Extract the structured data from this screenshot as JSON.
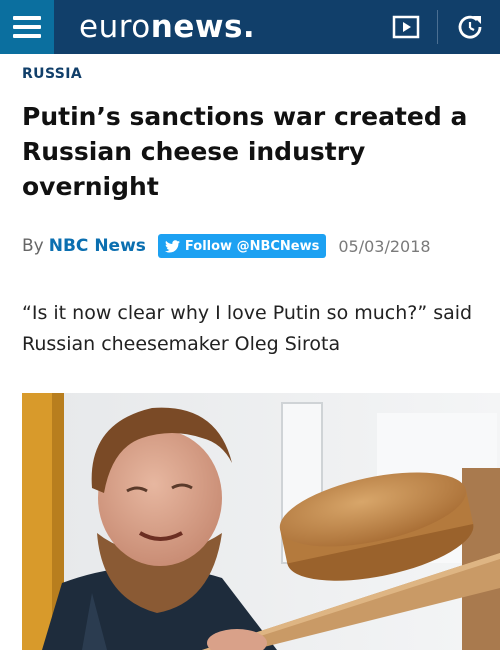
{
  "header": {
    "logo_regular": "euro",
    "logo_bold": "news.",
    "icons": [
      "menu-icon",
      "video-play-icon",
      "refresh-icon"
    ],
    "colors": {
      "bar": "#113f6a",
      "menu": "#0b6f9f"
    }
  },
  "article": {
    "section": "RUSSIA",
    "title": "Putin’s sanctions war created a Russian cheese industry overnight",
    "by_prefix": "By",
    "author": "NBC News",
    "follow_label": "Follow @NBCNews",
    "date": "05/03/2018",
    "quote": "“Is it now clear why I love Putin so much?” said Russian cheesemaker Oleg Sirota",
    "colors": {
      "author": "#0b6fb0",
      "follow_button": "#1da1f2"
    }
  }
}
